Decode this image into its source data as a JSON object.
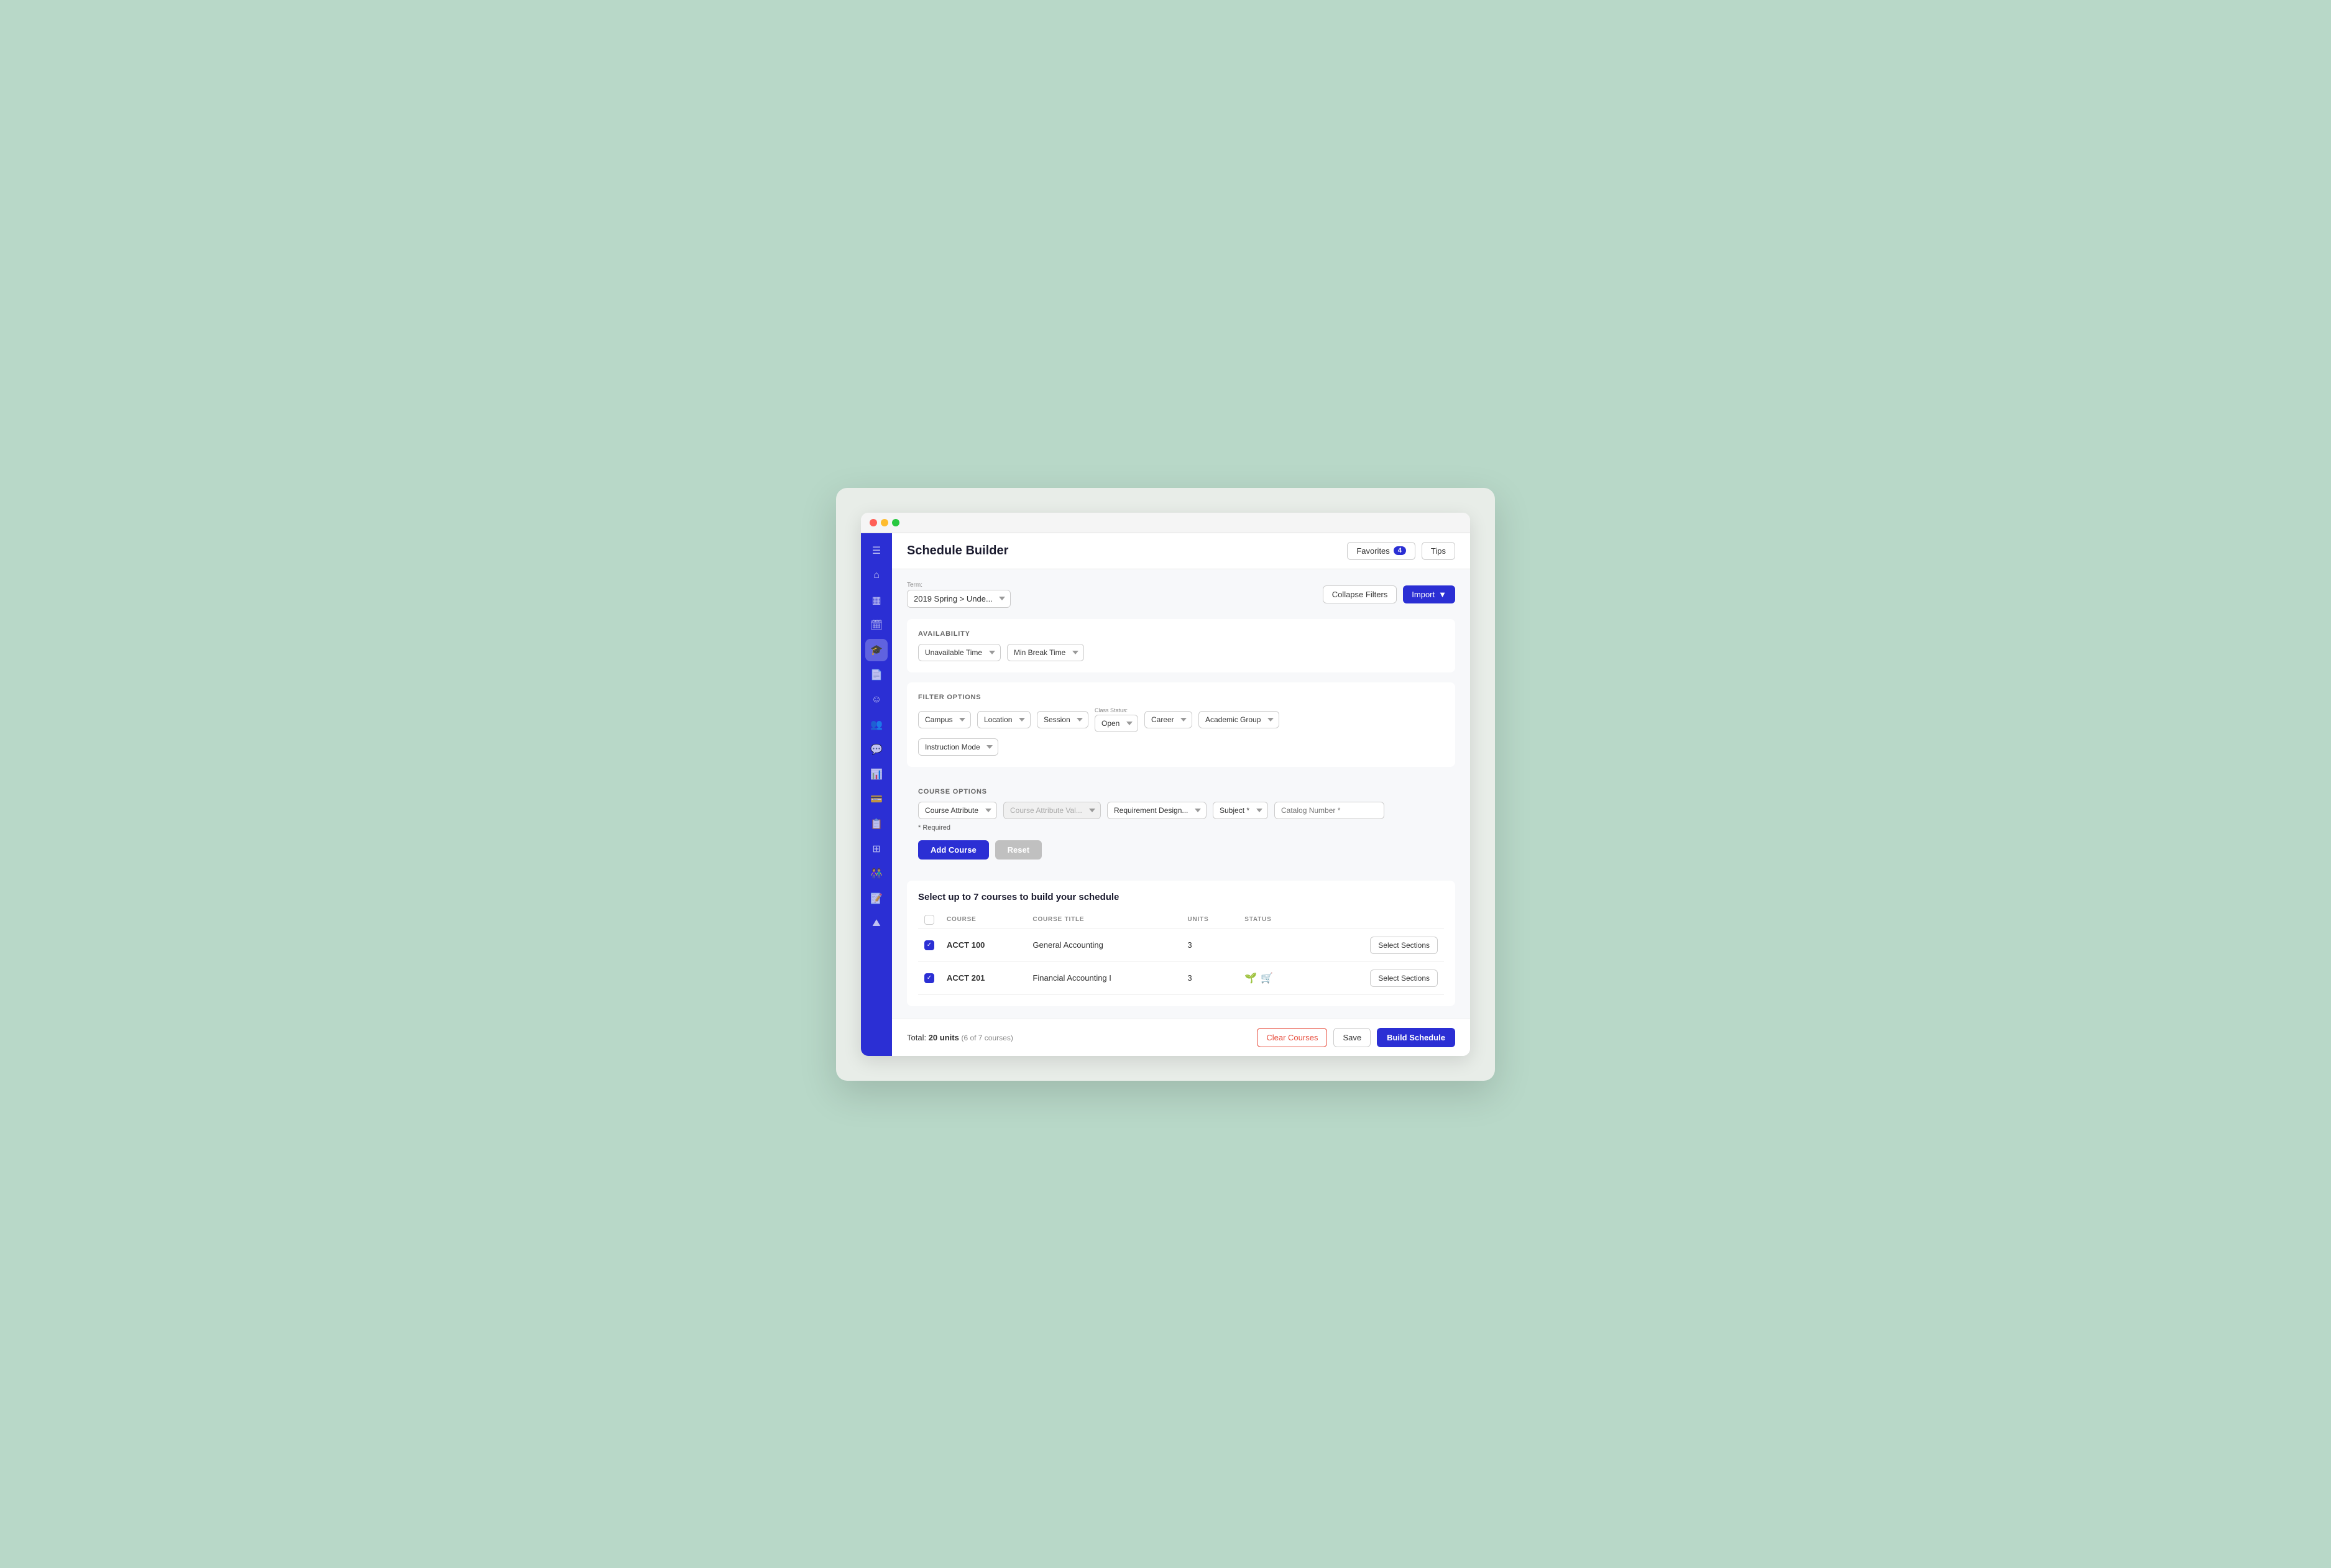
{
  "window": {
    "title": "Schedule Builder"
  },
  "topbar": {
    "title": "Schedule Builder",
    "favorites_label": "Favorites",
    "favorites_count": "4",
    "tips_label": "Tips",
    "collapse_filters_label": "Collapse Filters",
    "import_label": "Import"
  },
  "term": {
    "label": "Term:",
    "value": "2019 Spring > Unde..."
  },
  "availability": {
    "section_label": "AVAILABILITY",
    "unavailable_time": "Unavailable Time",
    "min_break_time": "Min Break Time"
  },
  "filter_options": {
    "section_label": "FILTER OPTIONS",
    "campus_label": "Campus",
    "location_label": "Location",
    "session_label": "Session",
    "class_status_label": "Class Status:",
    "class_status_value": "Open",
    "career_label": "Career",
    "academic_group_label": "Academic Group",
    "instruction_mode_label": "Instruction Mode"
  },
  "course_options": {
    "section_label": "COURSE OPTIONS",
    "course_attribute_label": "Course Attribute",
    "course_attribute_val_label": "Course Attribute Val...",
    "requirement_design_label": "Requirement Design...",
    "subject_label": "Subject *",
    "catalog_number_label": "Catalog Number *",
    "required_note": "* Required",
    "add_course_label": "Add Course",
    "reset_label": "Reset"
  },
  "table": {
    "header": "Select up to 7 courses to build your schedule",
    "col_course": "COURSE",
    "col_title": "COURSE TITLE",
    "col_units": "UNITS",
    "col_status": "STATUS",
    "rows": [
      {
        "checked": true,
        "course": "ACCT 100",
        "title": "General Accounting",
        "units": "3",
        "has_icons": false,
        "select_sections_label": "Select Sections"
      },
      {
        "checked": true,
        "course": "ACCT 201",
        "title": "Financial Accounting I",
        "units": "3",
        "has_icons": true,
        "select_sections_label": "Select Sections"
      }
    ]
  },
  "footer": {
    "total_label": "Total:",
    "total_value": "20 units",
    "total_sub": "(6 of 7 courses)",
    "clear_courses_label": "Clear Courses",
    "save_label": "Save",
    "build_schedule_label": "Build Schedule"
  },
  "sidebar": {
    "icons": [
      {
        "name": "menu-icon",
        "symbol": "☰",
        "active": false
      },
      {
        "name": "home-icon",
        "symbol": "⌂",
        "active": false
      },
      {
        "name": "grid-icon",
        "symbol": "▦",
        "active": false
      },
      {
        "name": "calendar-icon",
        "symbol": "📅",
        "active": false
      },
      {
        "name": "graduation-icon",
        "symbol": "🎓",
        "active": true
      },
      {
        "name": "document-icon",
        "symbol": "📄",
        "active": false
      },
      {
        "name": "face-icon",
        "symbol": "☺",
        "active": false
      },
      {
        "name": "users-icon",
        "symbol": "👥",
        "active": false
      },
      {
        "name": "chat-icon",
        "symbol": "💬",
        "active": false
      },
      {
        "name": "chart-icon",
        "symbol": "📊",
        "active": false
      },
      {
        "name": "card-icon",
        "symbol": "💳",
        "active": false
      },
      {
        "name": "list-icon",
        "symbol": "📋",
        "active": false
      },
      {
        "name": "table-icon",
        "symbol": "⊞",
        "active": false
      },
      {
        "name": "people-icon",
        "symbol": "👫",
        "active": false
      },
      {
        "name": "clipboard-icon",
        "symbol": "📝",
        "active": false
      },
      {
        "name": "mountain-icon",
        "symbol": "⛰",
        "active": false
      }
    ]
  }
}
